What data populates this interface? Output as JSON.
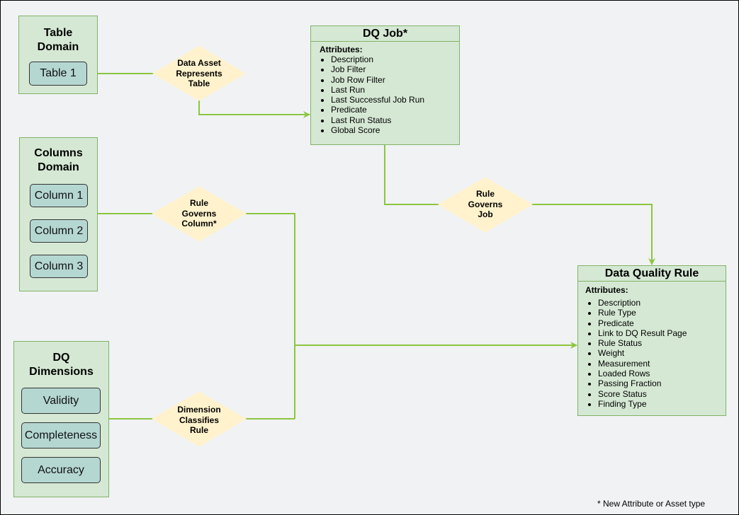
{
  "diagram": {
    "colors": {
      "background": "#f0f2f4",
      "domain_fill": "#d5e8d4",
      "domain_stroke": "#82b366",
      "asset_fill": "#b5d7d2",
      "relation_fill": "#fff2cc",
      "edge": "#8cc63f"
    },
    "domains": {
      "table": {
        "title_line1": "Table",
        "title_line2": "Domain",
        "assets": [
          "Table 1"
        ]
      },
      "columns": {
        "title_line1": "Columns",
        "title_line2": "Domain",
        "assets": [
          "Column 1",
          "Column 2",
          "Column 3"
        ]
      },
      "dimensions": {
        "title_line1": "DQ",
        "title_line2": "Dimensions",
        "assets": [
          "Validity",
          "Completeness",
          "Accuracy"
        ]
      }
    },
    "relations": {
      "data_asset_represents_table": [
        "Data Asset",
        "Represents",
        "Table"
      ],
      "rule_governs_column": [
        "Rule",
        "Governs",
        "Column*"
      ],
      "rule_governs_job": [
        "Rule",
        "Governs",
        "Job"
      ],
      "dimension_classifies_rule": [
        "Dimension",
        "Classifies",
        "Rule"
      ]
    },
    "entities": {
      "dq_job": {
        "title": "DQ Job*",
        "attributes_label": "Attributes:",
        "attributes": [
          "Description",
          "Job Filter",
          "Job Row Filter",
          "Last Run",
          "Last Successful Job Run",
          "Predicate",
          "Last Run Status",
          "Global Score"
        ]
      },
      "data_quality_rule": {
        "title": "Data Quality Rule",
        "attributes_label": "Attributes:",
        "attributes": [
          "Description",
          "Rule Type",
          "Predicate",
          "Link to DQ Result Page",
          "Rule Status",
          "Weight",
          "Measurement",
          "Loaded Rows",
          "Passing Fraction",
          "Score Status",
          "Finding Type"
        ]
      }
    },
    "footnote": "* New Attribute or Asset type"
  }
}
